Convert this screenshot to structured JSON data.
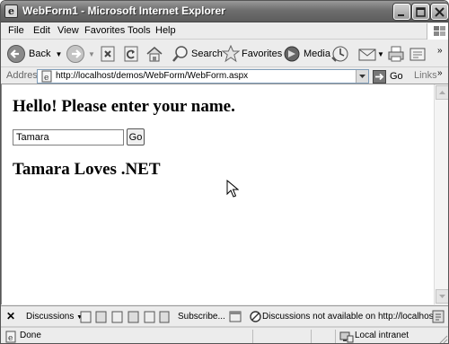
{
  "window": {
    "title": "WebForm1 - Microsoft Internet Explorer"
  },
  "menu": [
    "File",
    "Edit",
    "View",
    "Favorites",
    "Tools",
    "Help"
  ],
  "toolbar": {
    "back": "Back",
    "search": "Search",
    "favorites": "Favorites",
    "media": "Media"
  },
  "address": {
    "label": "Address",
    "url": "http://localhost/demos/WebForm/WebForm.aspx",
    "go": "Go",
    "links": "Links"
  },
  "page": {
    "heading": "Hello!  Please enter your name.",
    "input_value": "Tamara",
    "button_label": "Go",
    "output": "Tamara Loves .NET"
  },
  "discussions": {
    "label": "Discussions",
    "subscribe": "Subscribe...",
    "status": "Discussions not available on http://localhost/"
  },
  "status": {
    "left": "Done",
    "zone": "Local intranet"
  },
  "colors": {
    "titlebar": "#6e6e6e",
    "chrome": "#ececec"
  }
}
